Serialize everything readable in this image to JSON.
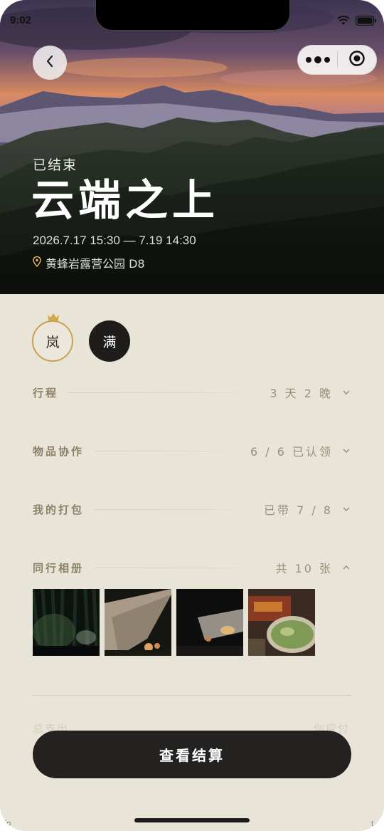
{
  "status_bar": {
    "time": "9:02"
  },
  "hero": {
    "status": "已结束",
    "title": "云端之上",
    "dates": "2026.7.17 15:30 — 7.19 14:30",
    "location": "黄蜂岩露营公园 D8"
  },
  "members": [
    {
      "name": "岚",
      "is_host": true
    },
    {
      "name": "满",
      "is_host": false
    }
  ],
  "sections": {
    "itinerary": {
      "label": "行程",
      "value": "3 天 2 晚",
      "expanded": false
    },
    "gear": {
      "label": "物品协作",
      "value": "6 / 6 已认领",
      "expanded": false
    },
    "packing": {
      "label": "我的打包",
      "value": "已带 7 / 8",
      "expanded": false
    },
    "album": {
      "label": "同行相册",
      "value": "共 10 张",
      "expanded": true
    }
  },
  "summary": {
    "left": "总支出",
    "right": "你应付"
  },
  "cta": {
    "label": "查看结算"
  },
  "corner": {
    "left": "trip",
    "right": "t"
  },
  "colors": {
    "accent_gold": "#c9a24f",
    "background": "#e9e4d8",
    "button_dark": "#242220"
  }
}
